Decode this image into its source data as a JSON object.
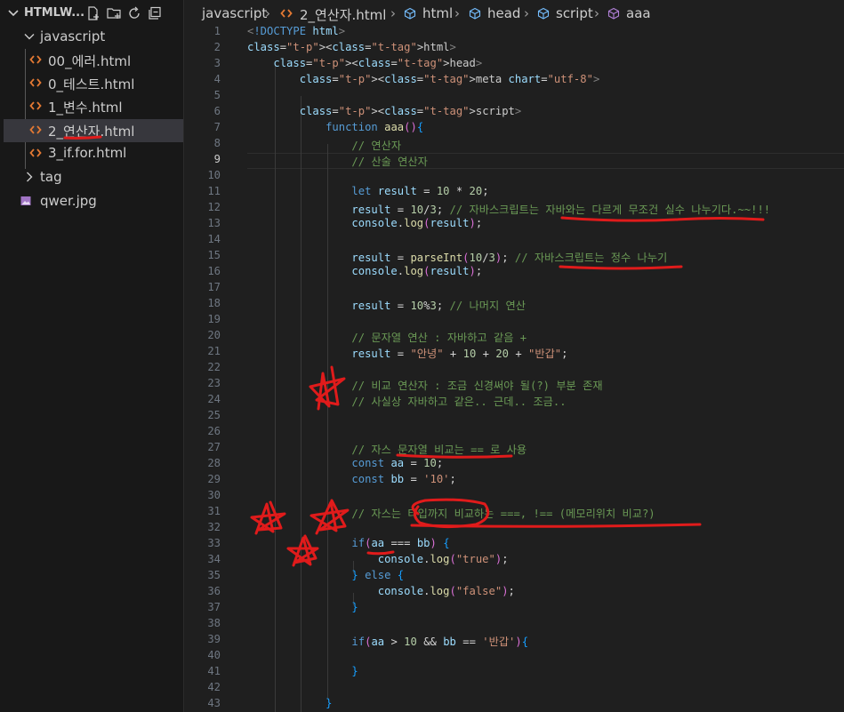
{
  "explorer": {
    "root_label": "HTMLW...",
    "actions": [
      "new-file-icon",
      "new-folder-icon",
      "refresh-icon",
      "collapse-icon"
    ],
    "items": [
      {
        "label": "javascript",
        "kind": "folder-open",
        "depth": 1
      },
      {
        "label": "00_에러.html",
        "kind": "html",
        "depth": 2
      },
      {
        "label": "0_테스트.html",
        "kind": "html",
        "depth": 2
      },
      {
        "label": "1_변수.html",
        "kind": "html",
        "depth": 2
      },
      {
        "label": "2_연산자.html",
        "kind": "html",
        "depth": 2,
        "selected": true
      },
      {
        "label": "3_if.for.html",
        "kind": "html",
        "depth": 2
      },
      {
        "label": "tag",
        "kind": "folder-closed",
        "depth": 1
      },
      {
        "label": "qwer.jpg",
        "kind": "image",
        "depth": 1
      }
    ]
  },
  "breadcrumb": [
    "javascript",
    "2_연산자.html",
    "html",
    "head",
    "script",
    "aaa"
  ],
  "editor": {
    "current_line": 9,
    "line_numbers": [
      "1",
      "2",
      "3",
      "4",
      "5",
      "6",
      "7",
      "8",
      "9",
      "10",
      "11",
      "12",
      "13",
      "14",
      "15",
      "16",
      "17",
      "18",
      "19",
      "20",
      "21",
      "22",
      "23",
      "24",
      "25",
      "26",
      "27",
      "28",
      "29",
      "30",
      "31",
      "32",
      "33",
      "34",
      "35",
      "36",
      "37",
      "38",
      "39",
      "40",
      "41",
      "42",
      "43"
    ],
    "lines": [
      "<!DOCTYPE html>",
      "<html>",
      "    <head>",
      "        <meta chart=\"utf-8\">",
      "",
      "        <script>",
      "            function aaa(){",
      "                // 연산자",
      "                // 산술 연산자",
      "",
      "                let result = 10 * 20;",
      "                result = 10/3; // 자바스크립트는 자바와는 다르게 무조건 실수 나누기다.~~!!!",
      "                console.log(result);",
      "",
      "                result = parseInt(10/3); // 자바스크립트는 정수 나누기",
      "                console.log(result);",
      "",
      "                result = 10%3; // 나머지 연산",
      "",
      "                // 문자열 연산 : 자바하고 같음 +",
      "                result = \"안녕\" + 10 + 20 + \"반갑\";",
      "",
      "                // 비교 연산자 : 조금 신경써야 될(?) 부분 존재",
      "                // 사실상 자바하고 같은.. 근데.. 조금..",
      "",
      "",
      "                // 자스 문자열 비교는 == 로 사용",
      "                const aa = 10;",
      "                const bb = '10';",
      "",
      "                // 자스는 타입까지 비교하는 ===, !== (메모리위치 비교?)",
      "",
      "                if(aa === bb) {",
      "                    console.log(\"true\");",
      "                } else {",
      "                    console.log(\"false\");",
      "                }",
      "",
      "                if(aa > 10 && bb == '반갑'){",
      "",
      "                }",
      "",
      "            }"
    ]
  },
  "annotation_color": "#e01b1b"
}
